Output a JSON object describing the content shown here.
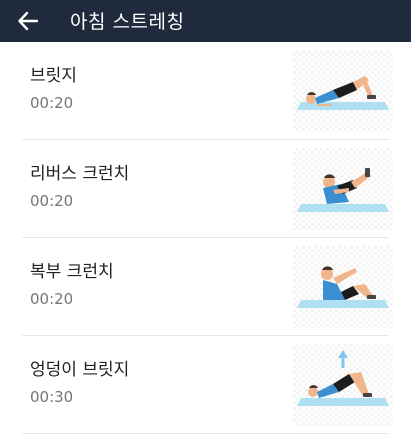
{
  "header": {
    "title": "아침 스트레칭",
    "back_icon": "arrow-left-icon"
  },
  "colors": {
    "appbar": "#1f2a3c",
    "mat": "#aee0f2",
    "skin": "#f0b58a",
    "shirt": "#3b8fd0",
    "shorts": "#1c1c1c",
    "arrow": "#7fc8ee"
  },
  "exercises": [
    {
      "name": "브릿지",
      "duration": "00:20",
      "illustration": "bridge-illustration"
    },
    {
      "name": "리버스 크런치",
      "duration": "00:20",
      "illustration": "reverse-crunch-illustration"
    },
    {
      "name": "복부 크런치",
      "duration": "00:20",
      "illustration": "abdominal-crunch-illustration"
    },
    {
      "name": "엉덩이 브릿지",
      "duration": "00:30",
      "illustration": "glute-bridge-illustration"
    }
  ]
}
